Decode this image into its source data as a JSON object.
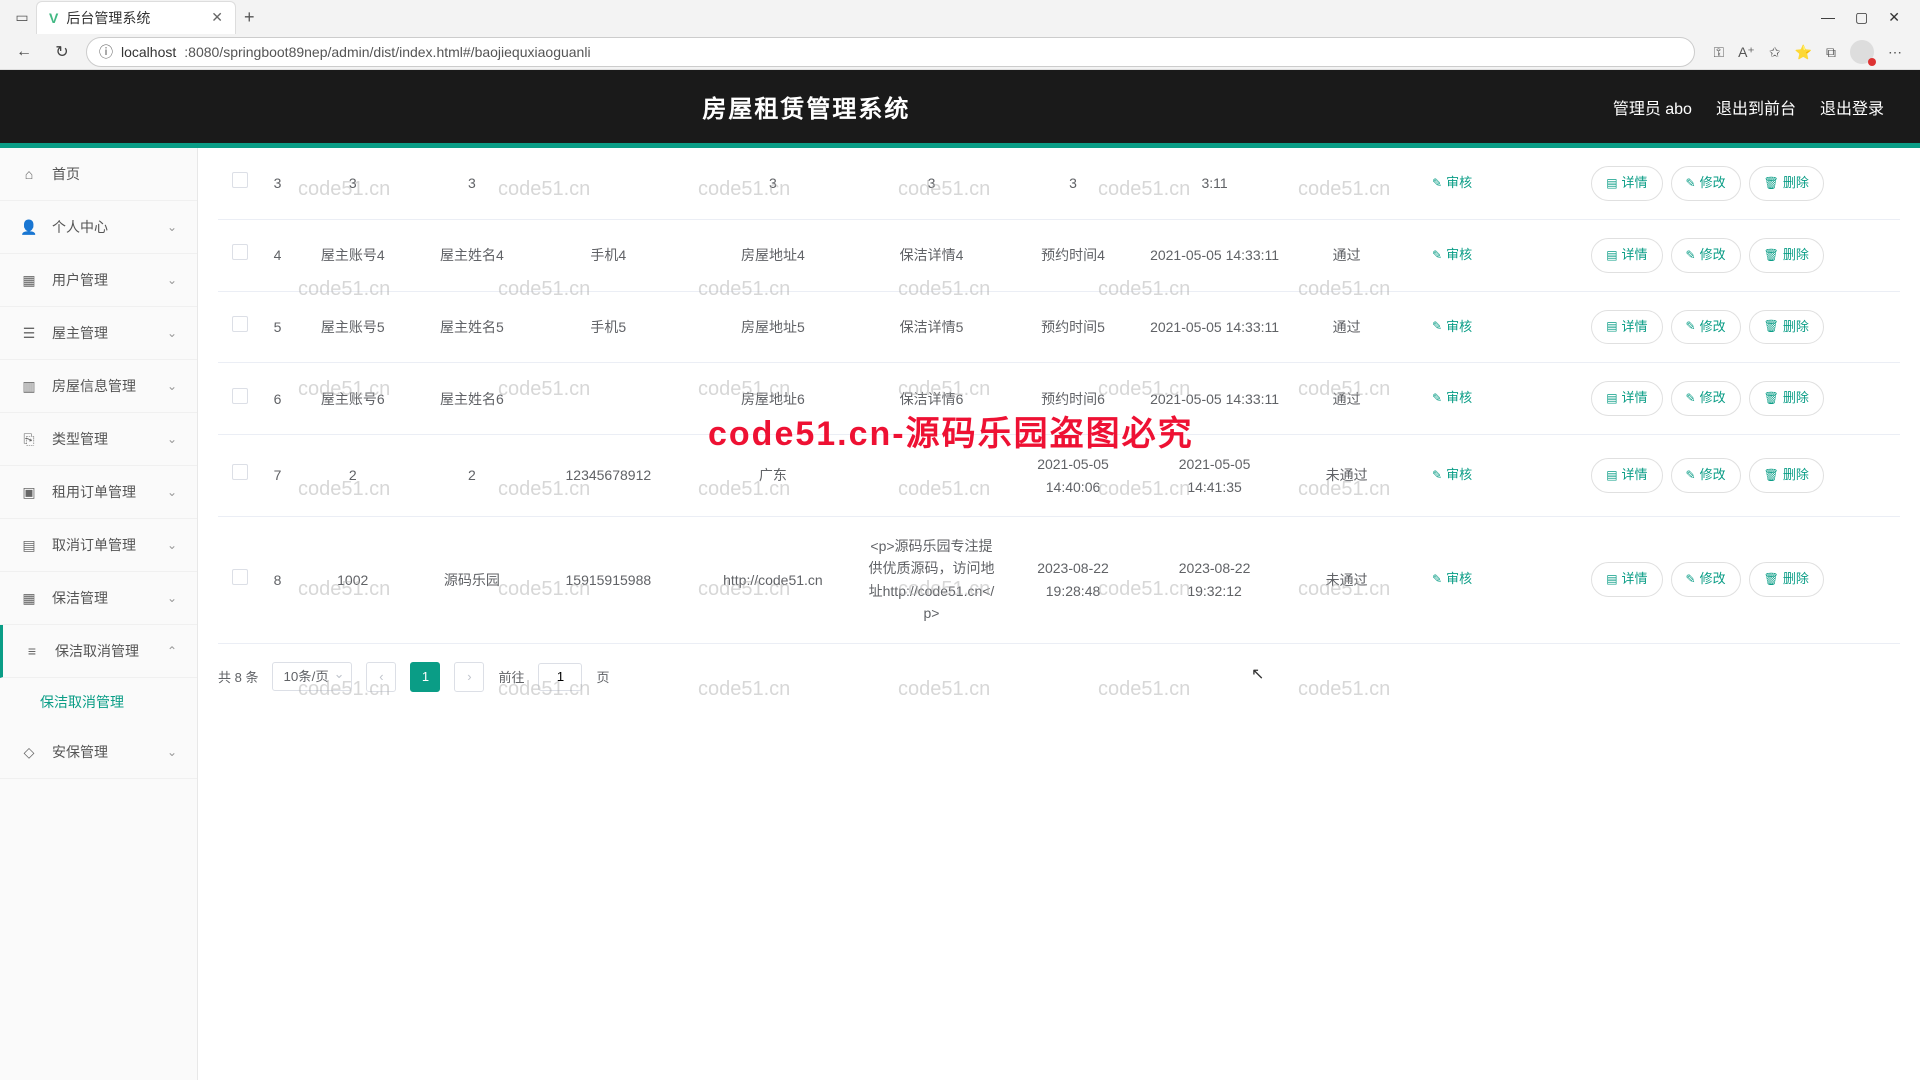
{
  "browser": {
    "tab_title": "后台管理系统",
    "url_host": "localhost",
    "url_path": ":8080/springboot89nep/admin/dist/index.html#/baojiequxiaoguanli"
  },
  "header": {
    "title": "房屋租赁管理系统",
    "user": "管理员 abo",
    "to_front": "退出到前台",
    "logout": "退出登录"
  },
  "sidebar": [
    {
      "label": "首页",
      "icon": "⌂"
    },
    {
      "label": "个人中心",
      "icon": "👤",
      "expandable": true
    },
    {
      "label": "用户管理",
      "icon": "▦",
      "expandable": true
    },
    {
      "label": "屋主管理",
      "icon": "☰",
      "expandable": true
    },
    {
      "label": "房屋信息管理",
      "icon": "▥",
      "expandable": true
    },
    {
      "label": "类型管理",
      "icon": "⎘",
      "expandable": true
    },
    {
      "label": "租用订单管理",
      "icon": "▣",
      "expandable": true
    },
    {
      "label": "取消订单管理",
      "icon": "▤",
      "expandable": true
    },
    {
      "label": "保洁管理",
      "icon": "▦",
      "expandable": true
    },
    {
      "label": "保洁取消管理",
      "icon": "≡",
      "expandable": true,
      "expanded": true,
      "children": [
        "保洁取消管理"
      ]
    },
    {
      "label": "安保管理",
      "icon": "◇",
      "expandable": true
    }
  ],
  "actions": {
    "audit": "审核",
    "detail": "详情",
    "edit": "修改",
    "delete": "删除"
  },
  "rows": [
    {
      "idx": "3",
      "c1": "3",
      "c2": "3",
      "c3": "",
      "c4": "3",
      "c5": "3",
      "c6": "3",
      "c7": "3:11",
      "c8": "",
      "status": ""
    },
    {
      "idx": "4",
      "c1": "屋主账号4",
      "c2": "屋主姓名4",
      "c3": "手机4",
      "c4": "房屋地址4",
      "c5": "保洁详情4",
      "c6": "预约时间4",
      "c7": "2021-05-05 14:33:11",
      "c8": "",
      "status": "通过"
    },
    {
      "idx": "5",
      "c1": "屋主账号5",
      "c2": "屋主姓名5",
      "c3": "手机5",
      "c4": "房屋地址5",
      "c5": "保洁详情5",
      "c6": "预约时间5",
      "c7": "2021-05-05 14:33:11",
      "c8": "",
      "status": "通过"
    },
    {
      "idx": "6",
      "c1": "屋主账号6",
      "c2": "屋主姓名6",
      "c3": "",
      "c4": "房屋地址6",
      "c5": "保洁详情6",
      "c6": "预约时间6",
      "c7": "2021-05-05 14:33:11",
      "c8": "",
      "status": "通过"
    },
    {
      "idx": "7",
      "c1": "2",
      "c2": "2",
      "c3": "12345678912",
      "c4": "广东",
      "c5": "",
      "c6": "2021-05-05 14:40:06",
      "c7": "2021-05-05 14:41:35",
      "c8": "",
      "status": "未通过"
    },
    {
      "idx": "8",
      "c1": "1002",
      "c2": "源码乐园",
      "c3": "15915915988",
      "c4": "http://code51.cn",
      "c5": "<p>源码乐园专注提供优质源码，访问地址http://code51.cn</p>",
      "c6": "2023-08-22 19:28:48",
      "c7": "2023-08-22 19:32:12",
      "c8": "",
      "status": "未通过"
    }
  ],
  "pagination": {
    "total_label": "共 8 条",
    "page_size": "10条/页",
    "current": "1",
    "goto_prefix": "前往",
    "goto_value": "1",
    "goto_suffix": "页"
  },
  "watermark": {
    "text": "code51.cn",
    "big": "code51.cn-源码乐园盗图必究"
  }
}
